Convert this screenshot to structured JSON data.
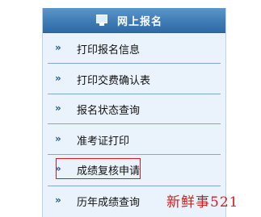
{
  "header": {
    "icon": "monitor-icon",
    "title": "网上报名"
  },
  "menu": {
    "arrow_glyph": "»",
    "items": [
      {
        "label": "打印报名信息"
      },
      {
        "label": "打印交费确认表"
      },
      {
        "label": "报名状态查询"
      },
      {
        "label": "准考证打印"
      },
      {
        "label": "成绩复核申请",
        "highlighted": true
      },
      {
        "label": "历年成绩查询"
      }
    ]
  },
  "watermark": "新鲜事521",
  "colors": {
    "header": "#3f7cb5",
    "panel_bg": "#eaf3fb",
    "separator": "#7fa9d2",
    "highlight_border": "#e0161b",
    "watermark": "#d21d1d"
  }
}
